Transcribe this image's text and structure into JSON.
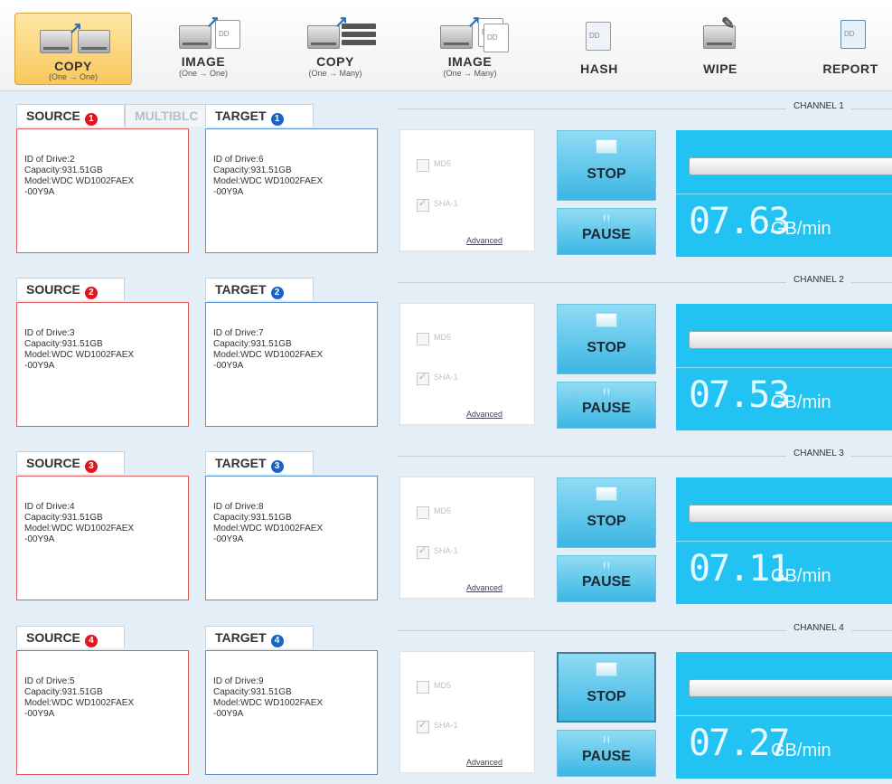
{
  "toolbar": [
    {
      "label": "COPY",
      "sub": "(One → One)"
    },
    {
      "label": "IMAGE",
      "sub": "(One → One)"
    },
    {
      "label": "COPY",
      "sub": "(One → Many)"
    },
    {
      "label": "IMAGE",
      "sub": "(One → Many)"
    },
    {
      "label": "HASH",
      "sub": ""
    },
    {
      "label": "WIPE",
      "sub": ""
    },
    {
      "label": "REPORT",
      "sub": ""
    }
  ],
  "channels": [
    {
      "title": "CHANNEL 1",
      "source_tab": "SOURCE",
      "source_badge": "1",
      "extra_tab": "MULTIBLC",
      "target_tab": "TARGET",
      "target_badge": "1",
      "source": {
        "line1": "ID of Drive:2",
        "line2": "Capacity:931.51GB",
        "line3": "Model:WDC WD1002FAEX",
        "line4": "-00Y9A"
      },
      "target": {
        "line1": "ID of Drive:6",
        "line2": "Capacity:931.51GB",
        "line3": "Model:WDC WD1002FAEX",
        "line4": "-00Y9A"
      },
      "md5": "MD5",
      "sha1": "SHA-1",
      "advanced": "Advanced",
      "stop": "STOP",
      "pause": "PAUSE",
      "speed": "07.63",
      "unit": "GB/min"
    },
    {
      "title": "CHANNEL 2",
      "source_tab": "SOURCE",
      "source_badge": "2",
      "target_tab": "TARGET",
      "target_badge": "2",
      "source": {
        "line1": "ID of Drive:3",
        "line2": "Capacity:931.51GB",
        "line3": "Model:WDC WD1002FAEX",
        "line4": "-00Y9A"
      },
      "target": {
        "line1": "ID of Drive:7",
        "line2": "Capacity:931.51GB",
        "line3": "Model:WDC WD1002FAEX",
        "line4": "-00Y9A"
      },
      "md5": "MD5",
      "sha1": "SHA-1",
      "advanced": "Advanced",
      "stop": "STOP",
      "pause": "PAUSE",
      "speed": "07.53",
      "unit": "GB/min"
    },
    {
      "title": "CHANNEL 3",
      "source_tab": "SOURCE",
      "source_badge": "3",
      "target_tab": "TARGET",
      "target_badge": "3",
      "source": {
        "line1": "ID of Drive:4",
        "line2": "Capacity:931.51GB",
        "line3": "Model:WDC WD1002FAEX",
        "line4": "-00Y9A"
      },
      "target": {
        "line1": "ID of Drive:8",
        "line2": "Capacity:931.51GB",
        "line3": "Model:WDC WD1002FAEX",
        "line4": "-00Y9A"
      },
      "md5": "MD5",
      "sha1": "SHA-1",
      "advanced": "Advanced",
      "stop": "STOP",
      "pause": "PAUSE",
      "speed": "07.11",
      "unit": "GB/min"
    },
    {
      "title": "CHANNEL 4",
      "source_tab": "SOURCE",
      "source_badge": "4",
      "target_tab": "TARGET",
      "target_badge": "4",
      "source": {
        "line1": "ID of Drive:5",
        "line2": "Capacity:931.51GB",
        "line3": "Model:WDC WD1002FAEX",
        "line4": "-00Y9A"
      },
      "target": {
        "line1": "ID of Drive:9",
        "line2": "Capacity:931.51GB",
        "line3": "Model:WDC WD1002FAEX",
        "line4": "-00Y9A"
      },
      "md5": "MD5",
      "sha1": "SHA-1",
      "advanced": "Advanced",
      "stop": "STOP",
      "pause": "PAUSE",
      "speed": "07.27",
      "unit": "GB/min"
    }
  ],
  "colors": {
    "accent": "#22c2f2",
    "source_border": "#e05a5a",
    "target_border": "#5b8fc6",
    "active_tool": "#f8c85b"
  }
}
